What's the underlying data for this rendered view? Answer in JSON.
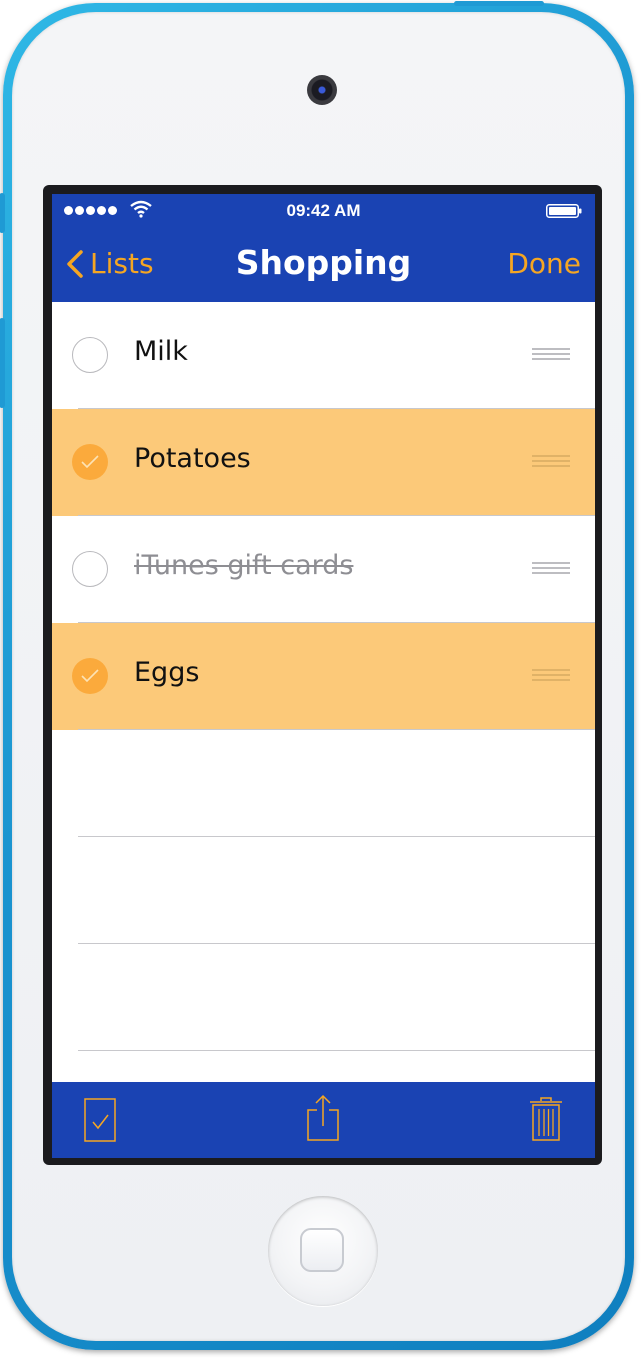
{
  "status_bar": {
    "time": "09:42 AM",
    "signal_dots": 5
  },
  "nav": {
    "back_label": "Lists",
    "title": "Shopping",
    "done_label": "Done"
  },
  "items": [
    {
      "label": "Milk",
      "checked": false,
      "struck": false
    },
    {
      "label": "Potatoes",
      "checked": true,
      "struck": false
    },
    {
      "label": "iTunes gift cards",
      "checked": false,
      "struck": true
    },
    {
      "label": "Eggs",
      "checked": true,
      "struck": false
    }
  ],
  "toolbar": {
    "icons": [
      "check-all-icon",
      "share-icon",
      "trash-icon"
    ]
  },
  "colors": {
    "bar_blue": "#1a43b3",
    "accent_orange": "#f5a623",
    "checked_row": "#fcc979",
    "check_circle": "#fbaa3c"
  }
}
